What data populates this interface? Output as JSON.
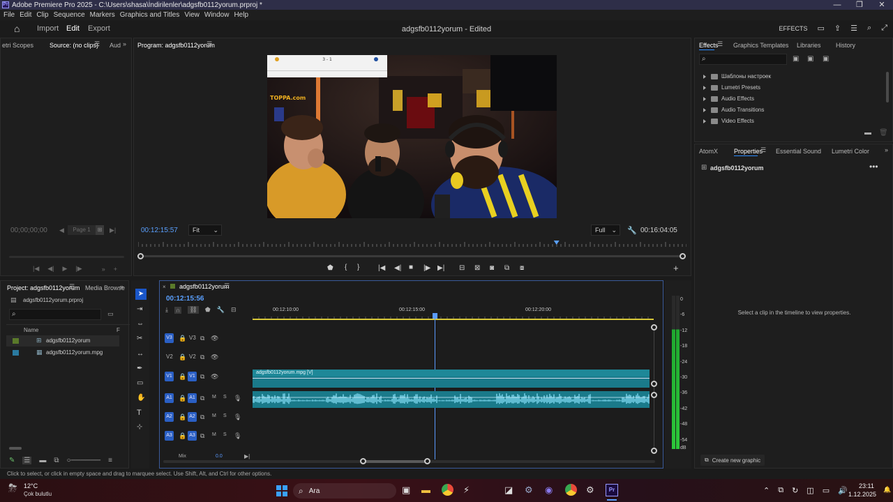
{
  "window": {
    "title": "Adobe Premiere Pro 2025 - C:\\Users\\shasa\\İndirilenler\\adgsfb0112yorum.prproj *",
    "app_icon": "Pr"
  },
  "menu": [
    "File",
    "Edit",
    "Clip",
    "Sequence",
    "Markers",
    "Graphics and Titles",
    "View",
    "Window",
    "Help"
  ],
  "header": {
    "nav": [
      "Import",
      "Edit",
      "Export"
    ],
    "active_nav": "Edit",
    "project_title": "adgsfb0112yorum - Edited",
    "effects_label": "EFFECTS"
  },
  "source_panel": {
    "tabs": [
      "etri Scopes",
      "Source: (no clips)",
      "Aud"
    ],
    "timecode": "00;00;00;00",
    "page": "Page 1"
  },
  "program_panel": {
    "title": "Program: adgsfb0112yorum",
    "timecode": "00:12:15:57",
    "fit": "Fit",
    "quality": "Full",
    "duration": "00:16:04:05",
    "playhead_fraction": 0.763
  },
  "effects_panel": {
    "tabs": [
      "Effects",
      "Graphics Templates",
      "Libraries",
      "History"
    ],
    "folders": [
      "Шаблоны настроек",
      "Lumetri Presets",
      "Audio Effects",
      "Audio Transitions",
      "Video Effects"
    ]
  },
  "properties_panel": {
    "tabs": [
      "AtomX",
      "Properties",
      "Essential Sound",
      "Lumetri Color"
    ],
    "item": "adgsfb0112yorum",
    "message": "Select a clip in the timeline to view properties.",
    "create_button": "Create new graphic"
  },
  "project_panel": {
    "tabs": [
      "Project: adgsfb0112yorum",
      "Media Browse"
    ],
    "file": "adgsfb0112yorum.prproj",
    "column": "Name",
    "column_f": "F",
    "items": [
      {
        "name": "adgsfb0112yorum",
        "color": "#5a7a2a"
      },
      {
        "name": "adgsfb0112yorum.mpg",
        "color": "#2a7aa0"
      }
    ]
  },
  "timeline": {
    "tab": "adgsfb0112yorum",
    "timecode": "00:12:15:56",
    "ruler": [
      "00:12:10:00",
      "00:12:15:00",
      "00:12:20:00"
    ],
    "video_tracks": [
      "V3",
      "V2",
      "V1"
    ],
    "audio_tracks": [
      "A1",
      "A2",
      "A3"
    ],
    "mix_label": "Mix",
    "mix_value": "0.0",
    "clip_label": "adgsfb0112yorum.mpg [V]",
    "m": "M",
    "s": "S"
  },
  "meter": {
    "labels": [
      "0",
      "-6",
      "-12",
      "-18",
      "-24",
      "-30",
      "-36",
      "-42",
      "-48",
      "-54",
      "dB"
    ]
  },
  "status": "Click to select, or click in empty space and drag to marquee select. Use Shift, Alt, and Ctrl for other options.",
  "video_overlay": {
    "score": "3 - 1",
    "shop_sign": "TOPPA.com"
  },
  "taskbar": {
    "temp": "12°C",
    "weather": "Çok bulutlu",
    "search": "Ara",
    "time": "23:11",
    "date": "1.12.2025"
  }
}
